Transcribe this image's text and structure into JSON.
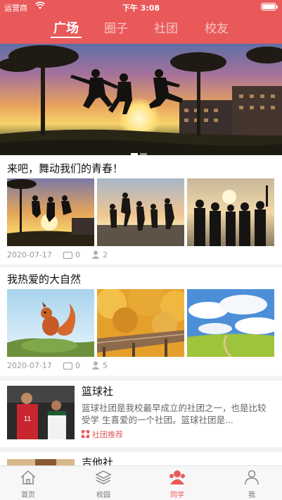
{
  "status_bar": {
    "carrier": "运营商",
    "time": "下午 3:08"
  },
  "top_tabs": [
    {
      "label": "广场",
      "active": true
    },
    {
      "label": "圈子",
      "active": false
    },
    {
      "label": "社团",
      "active": false
    },
    {
      "label": "校友",
      "active": false
    }
  ],
  "banner": {
    "page_count": 2,
    "current_page": 1
  },
  "posts": [
    {
      "title": "来吧，舞动我们的青春！",
      "date": "2020-07-17",
      "comments": "0",
      "members": "2",
      "images": [
        "silhouette-jump-sunset",
        "silhouette-jump-beach",
        "silhouette-group-pier"
      ]
    },
    {
      "title": "我热爱的大自然",
      "date": "2020-07-17",
      "comments": "0",
      "members": "5",
      "images": [
        "red-squirrel",
        "autumn-boardwalk",
        "green-field-clouds"
      ]
    }
  ],
  "clubs": [
    {
      "name": "篮球社",
      "description": "篮球社团是我校最早成立的社团之一，也是比较受学 生喜爱的一个社团。篮球社团是...",
      "tag": "社团推荐",
      "image": "basketball-players"
    },
    {
      "name": "吉他社",
      "image": "guitar"
    }
  ],
  "bottom_tabs": [
    {
      "label": "首页",
      "icon": "home-icon",
      "active": false
    },
    {
      "label": "校园",
      "icon": "layers-icon",
      "active": false
    },
    {
      "label": "同学",
      "icon": "classmates-icon",
      "active": true
    },
    {
      "label": "我",
      "icon": "person-icon",
      "active": false
    }
  ],
  "colors": {
    "brand": "#e9595a",
    "tab_bar_bg": "#f7f7f7",
    "meta_text": "#9a9a9a"
  }
}
